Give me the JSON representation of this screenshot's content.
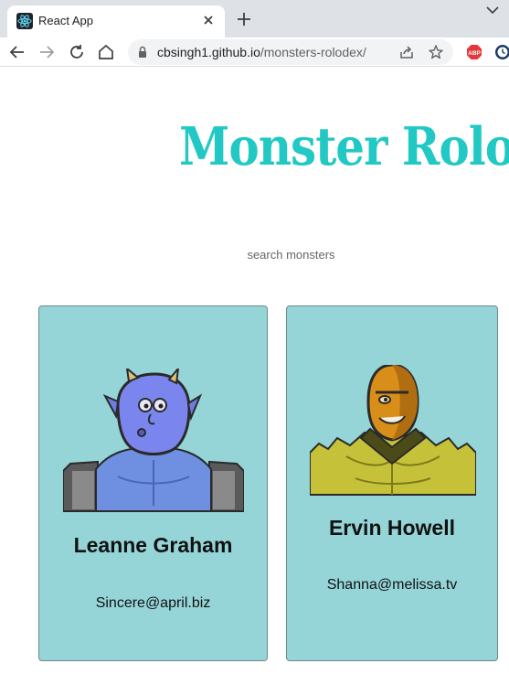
{
  "browser": {
    "tab_title": "React App",
    "url_domain": "cbsingh1.github.io",
    "url_path": "/monsters-rolodex/",
    "extension_badge": "ABP"
  },
  "page": {
    "title": "Monster Rolodex",
    "search_placeholder": "search monsters",
    "accent_color": "#22c9c4",
    "card_color": "#95d5d8"
  },
  "monsters": [
    {
      "name": "Leanne Graham",
      "email": "Sincere@april.biz"
    },
    {
      "name": "Ervin Howell",
      "email": "Shanna@melissa.tv"
    }
  ]
}
